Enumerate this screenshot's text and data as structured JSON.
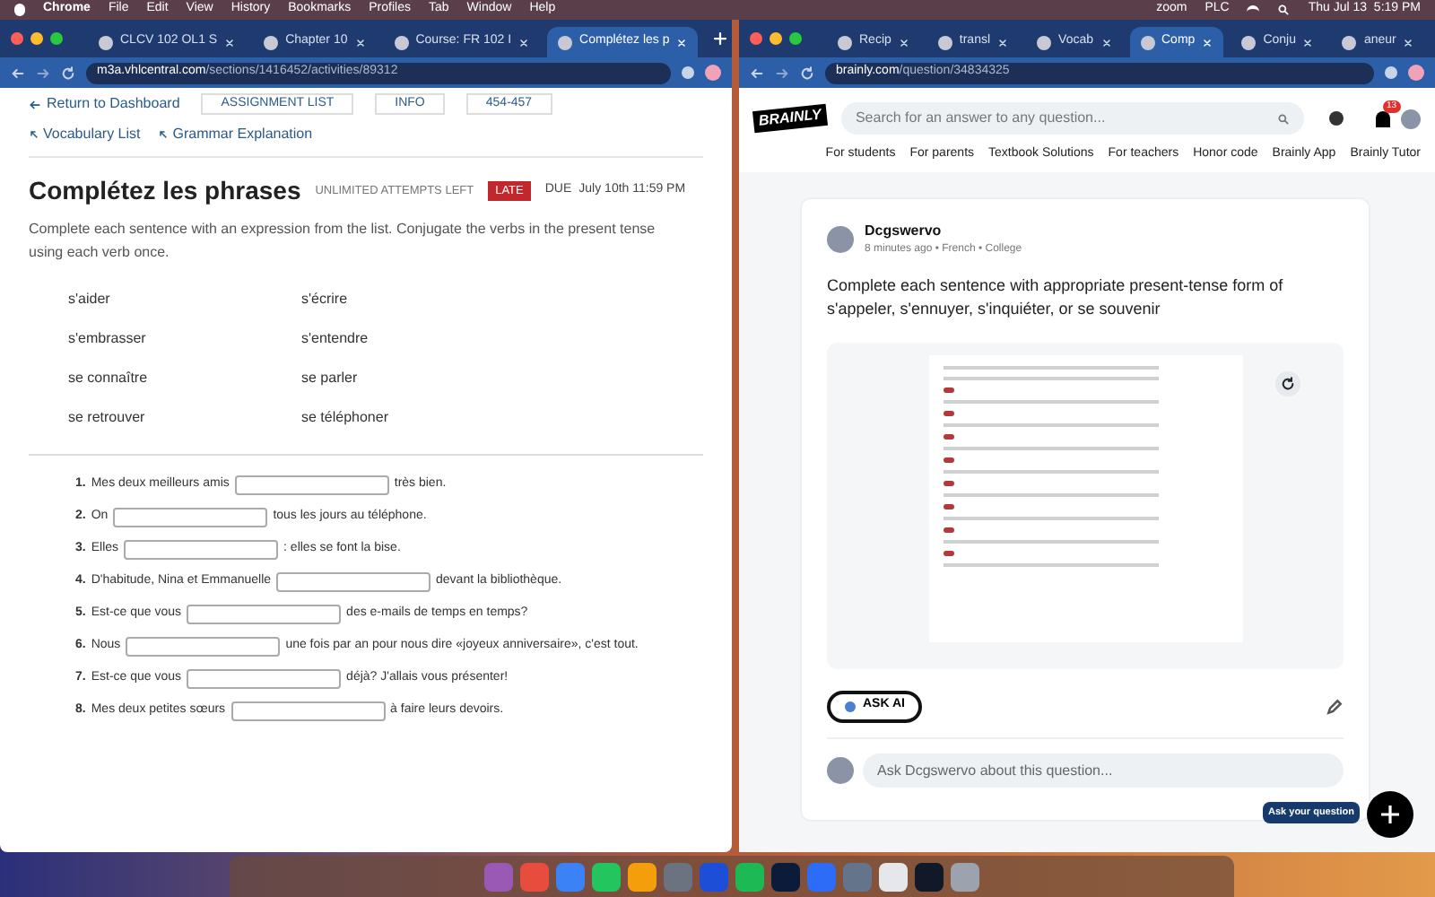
{
  "menu_bar": {
    "app": "Chrome",
    "items": [
      "File",
      "Edit",
      "View",
      "History",
      "Bookmarks",
      "Profiles",
      "Tab",
      "Window",
      "Help"
    ],
    "zoom": "zoom",
    "plc": "PLC",
    "clock": "Thu Jul 13  5:19 PM"
  },
  "left_browser": {
    "tabs": [
      {
        "title": "CLCV 102 OL1 S",
        "selected": false
      },
      {
        "title": "Chapter 10",
        "selected": false
      },
      {
        "title": "Course: FR 102 I",
        "selected": false
      },
      {
        "title": "Complétez les p",
        "selected": true
      }
    ],
    "url": {
      "domain": "m3a.vhlcentral.com",
      "path": "/sections/1416452/activities/89312"
    },
    "page": {
      "back_link": "Return to Dashboard",
      "nav_buttons": [
        "ASSIGNMENT LIST",
        "INFO",
        "454-457"
      ],
      "links": [
        "Vocabulary List",
        "Grammar Explanation"
      ],
      "title": "Complétez les phrases",
      "attempts": "UNLIMITED ATTEMPTS LEFT",
      "late_badge": "LATE",
      "due_label": "DUE",
      "due": "July 10th 11:59 PM",
      "instructions": "Complete each sentence with an expression from the list. Conjugate the verbs in the present tense using each verb once.",
      "expressions": [
        "s'aider",
        "s'écrire",
        "s'embrasser",
        "s'entendre",
        "se connaître",
        "se parler",
        "se retrouver",
        "se téléphoner"
      ],
      "sentences": [
        {
          "number": "1.",
          "before": "Mes deux meilleurs amis",
          "after": "très bien."
        },
        {
          "number": "2.",
          "before": "On",
          "after": "tous les jours au téléphone."
        },
        {
          "number": "3.",
          "before": "Elles",
          "after": ": elles se font la bise."
        },
        {
          "number": "4.",
          "before": "D'habitude, Nina et Emmanuelle",
          "after": "devant la bibliothèque."
        },
        {
          "number": "5.",
          "before": "Est-ce que vous",
          "after": "des e-mails de temps en temps?"
        },
        {
          "number": "6.",
          "before": "Nous",
          "after": "une fois par an pour nous dire «joyeux anniversaire», c'est tout."
        },
        {
          "number": "7.",
          "before": "Est-ce que vous",
          "after": "déjà? J'allais vous présenter!"
        },
        {
          "number": "8.",
          "before": "Mes deux petites sœurs",
          "after": "à faire leurs devoirs."
        }
      ]
    }
  },
  "right_browser": {
    "tabs": [
      {
        "title": "Recip",
        "selected": false
      },
      {
        "title": "transl",
        "selected": false
      },
      {
        "title": "Vocab",
        "selected": false
      },
      {
        "title": "Comp",
        "selected": true
      },
      {
        "title": "Conju",
        "selected": false
      },
      {
        "title": "aneur",
        "selected": false
      }
    ],
    "url": {
      "domain": "brainly.com",
      "path": "/question/34834325"
    },
    "page": {
      "logo": "BRAINLY",
      "search_placeholder": "Search for an answer to any question...",
      "notification_count": "13",
      "nav": [
        "For students",
        "For parents",
        "Textbook Solutions",
        "For teachers",
        "Honor code",
        "Brainly App",
        "Brainly Tutor"
      ],
      "question": {
        "author": "Dcgswervo",
        "meta": "8 minutes ago • French • College",
        "text": "Complete each sentence with appropriate present-tense form of s'appeler, s'ennuyer, s'inquiéter, or se souvenir",
        "ask_ai": "ASK AI",
        "comment_placeholder": "Ask Dcgswervo about this question..."
      },
      "fab_tooltip": "Ask your question"
    }
  }
}
